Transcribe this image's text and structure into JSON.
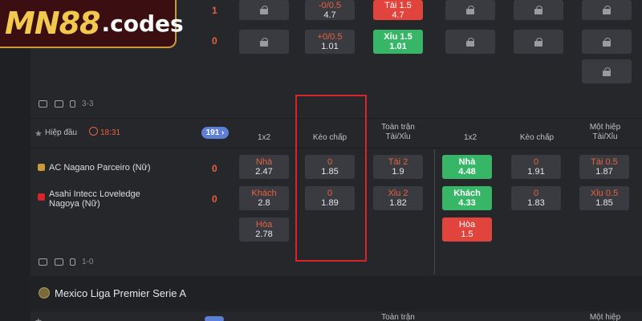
{
  "logo": {
    "brand": "MN88",
    "suffix": ".codes"
  },
  "match1": {
    "scores": [
      "1",
      "0"
    ],
    "hdp_cells": [
      {
        "k": "-0/0.5",
        "v": "4.7"
      },
      {
        "k": "+0/0.5",
        "v": "1.01"
      }
    ],
    "ou_cells": [
      {
        "k": "Tài 1.5",
        "v": "4.7"
      },
      {
        "k": "Xỉu 1.5",
        "v": "1.01"
      }
    ],
    "footer_count": "3-3"
  },
  "section_header": {
    "league": "Hiệp đầu",
    "time": "18:31",
    "badge": "191",
    "col_1x2": "1x2",
    "col_hdp": "Kèo chấp",
    "col_ou": "Toàn trận\nTài/Xỉu",
    "col_1x2_half": "1x2",
    "col_hdp_half": "Kèo chấp",
    "col_ou_half": "Một hiệp\nTài/Xỉu"
  },
  "match2": {
    "home": "AC Nagano Parceiro (Nữ)",
    "away_line1": "Asahi Intecc Loveledge",
    "away_line2": "Nagoya (Nữ)",
    "home_score": "0",
    "away_score": "0",
    "full_1x2": [
      {
        "k": "Nhà",
        "v": "2.47"
      },
      {
        "k": "Khách",
        "v": "2.8"
      },
      {
        "k": "Hòa",
        "v": "2.78"
      }
    ],
    "full_hdp": [
      {
        "k": "0",
        "v": "1.85"
      },
      {
        "k": "0",
        "v": "1.89"
      }
    ],
    "full_ou": [
      {
        "k": "Tài 2",
        "v": "1.9"
      },
      {
        "k": "Xỉu 2",
        "v": "1.82"
      }
    ],
    "half_1x2": [
      {
        "k": "Nhà",
        "v": "4.48"
      },
      {
        "k": "Khách",
        "v": "4.33"
      },
      {
        "k": "Hòa",
        "v": "1.5"
      }
    ],
    "half_hdp": [
      {
        "k": "0",
        "v": "1.91"
      },
      {
        "k": "0",
        "v": "1.83"
      }
    ],
    "half_ou": [
      {
        "k": "Tài 0.5",
        "v": "1.87"
      },
      {
        "k": "Xỉu 0.5",
        "v": "1.85"
      }
    ],
    "footer_count": "1-0"
  },
  "league2": {
    "name": "Mexico Liga Premier Serie A"
  },
  "bottom_header": {
    "col_ou": "Toàn trận",
    "col_ou_half": "Một hiệp"
  },
  "colors": {
    "odds_key": "#e8613f",
    "up": "#38b667",
    "down": "#e0443c",
    "highlight": "#d8232a"
  }
}
